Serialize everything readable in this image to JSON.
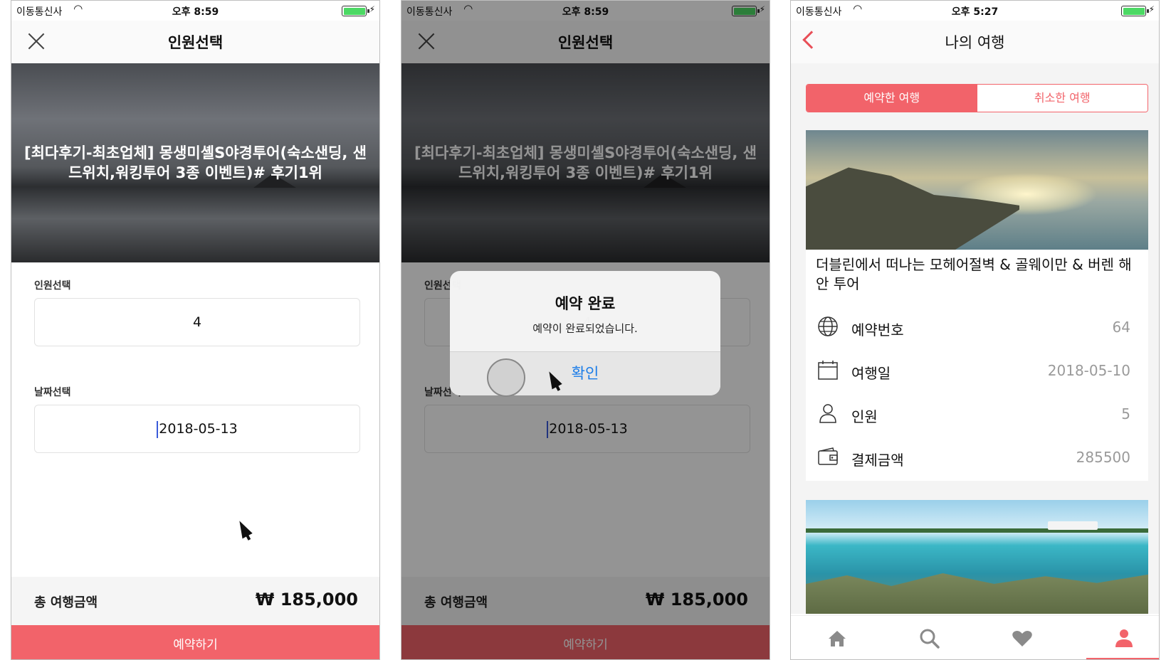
{
  "status_left": {
    "carrier": "이동통신사",
    "time": "오후 8:59"
  },
  "status_mid": {
    "carrier": "이동통신사",
    "time": "오후 8:59"
  },
  "status_right": {
    "carrier": "이동통신사",
    "time": "오후 5:27"
  },
  "select_screen": {
    "nav_title": "인원선택",
    "hero_title": "[최다후기-최초업체] 몽생미셸S야경투어(숙소샌딩, 샌드위치,워킹투어 3종 이벤트)# 후기1위",
    "people_label": "인원선택",
    "people_value": "4",
    "date_label": "날짜선택",
    "date_value": "2018-05-13",
    "total_label": "총 여행금액",
    "total_value": "₩ 185,000",
    "reserve_button": "예약하기"
  },
  "alert": {
    "title": "예약 완료",
    "message": "예약이 완료되었습니다.",
    "confirm_button": "확인"
  },
  "my_trips": {
    "nav_title": "나의 여행",
    "tabs": [
      "예약한 여행",
      "취소한 여행"
    ],
    "active_tab": 0,
    "card": {
      "title": "더블린에서 떠나는 모헤어절벽 & 골웨이만 & 버렌 해안 투어",
      "rows": [
        {
          "icon": "globe-icon",
          "label": "예약번호",
          "value": "64"
        },
        {
          "icon": "calendar-icon",
          "label": "여행일",
          "value": "2018-05-10"
        },
        {
          "icon": "person-icon",
          "label": "인원",
          "value": "5"
        },
        {
          "icon": "wallet-icon",
          "label": "결제금액",
          "value": "285500"
        }
      ]
    },
    "tabbar": [
      "home-icon",
      "search-icon",
      "heart-icon",
      "profile-icon"
    ]
  },
  "colors": {
    "accent": "#f2636a",
    "link": "#1a7ce8",
    "battery": "#4cd964"
  }
}
